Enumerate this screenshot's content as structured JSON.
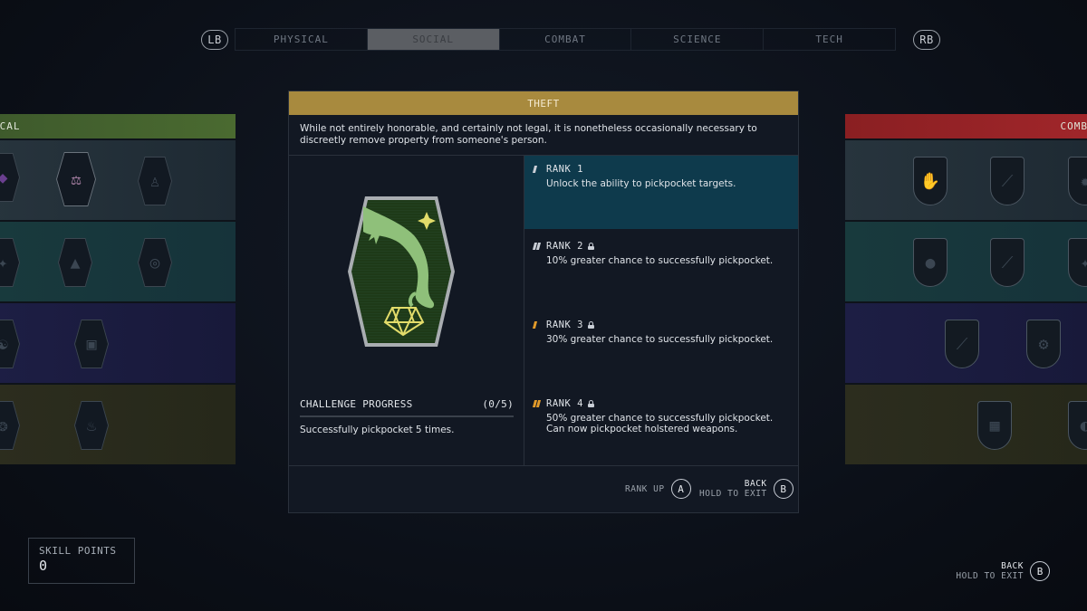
{
  "nav": {
    "prev_button": "LB",
    "next_button": "RB",
    "tabs": [
      {
        "label": "PHYSICAL",
        "active": false
      },
      {
        "label": "SOCIAL",
        "active": true
      },
      {
        "label": "COMBAT",
        "active": false
      },
      {
        "label": "SCIENCE",
        "active": false
      },
      {
        "label": "TECH",
        "active": false
      }
    ]
  },
  "left_panel": {
    "title": "ICAL",
    "accent": "#4a6a30"
  },
  "right_panel": {
    "title": "COMB",
    "accent": "#a0262a"
  },
  "skill": {
    "name": "THEFT",
    "header_color": "#a88a3e",
    "description": "While not entirely honorable, and certainly not legal, it is nonetheless occasionally necessary to discreetly remove property from someone's person.",
    "icon": "hand-pickpocket-gem-icon",
    "challenge": {
      "title": "CHALLENGE PROGRESS",
      "progress": "(0/5)",
      "current": 0,
      "total": 5,
      "description": "Successfully pickpocket 5 times."
    },
    "ranks": [
      {
        "label": "RANK 1",
        "locked": false,
        "active": true,
        "description": "Unlock the ability to pickpocket targets."
      },
      {
        "label": "RANK 2",
        "locked": true,
        "active": false,
        "description": "10% greater chance to successfully pickpocket."
      },
      {
        "label": "RANK 3",
        "locked": true,
        "active": false,
        "description": "30% greater chance to successfully pickpocket."
      },
      {
        "label": "RANK 4",
        "locked": true,
        "active": false,
        "description": "50% greater chance to successfully pickpocket. Can now pickpocket holstered weapons."
      }
    ]
  },
  "controls": {
    "rank_up_label": "RANK UP",
    "rank_up_key": "A",
    "back_label": "BACK",
    "back_hold": "HOLD TO EXIT",
    "back_key": "B"
  },
  "skill_points": {
    "label": "SKILL POINTS",
    "value": "0"
  },
  "global_back": {
    "label": "BACK",
    "hold": "HOLD TO EXIT",
    "key": "B"
  }
}
